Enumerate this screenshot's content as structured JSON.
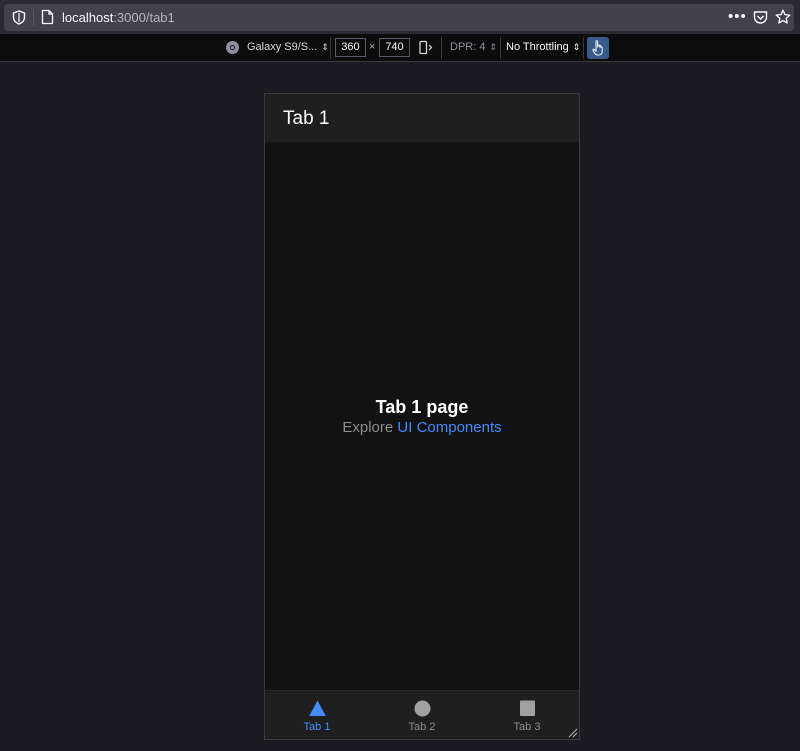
{
  "browser": {
    "url_host": "localhost",
    "url_rest": ":3000/tab1",
    "more_label": "•••"
  },
  "rdm": {
    "device_label": "Galaxy S9/S...",
    "width_value": "360",
    "times_label": "×",
    "height_value": "740",
    "dpr_label": "DPR: 4",
    "throttling_label": "No Throttling",
    "caret": "⇕"
  },
  "app": {
    "header_title": "Tab 1",
    "page_title": "Tab 1 page",
    "explore_text": "Explore ",
    "explore_link": "UI Components",
    "tabs": [
      {
        "label": "Tab 1",
        "icon": "triangle-icon",
        "active": true
      },
      {
        "label": "Tab 2",
        "icon": "circle-icon",
        "active": false
      },
      {
        "label": "Tab 3",
        "icon": "square-icon",
        "active": false
      }
    ]
  },
  "colors": {
    "accent": "#428cff",
    "inactive": "#8c8c8c",
    "background": "#121212",
    "header": "#1f1f1f"
  }
}
